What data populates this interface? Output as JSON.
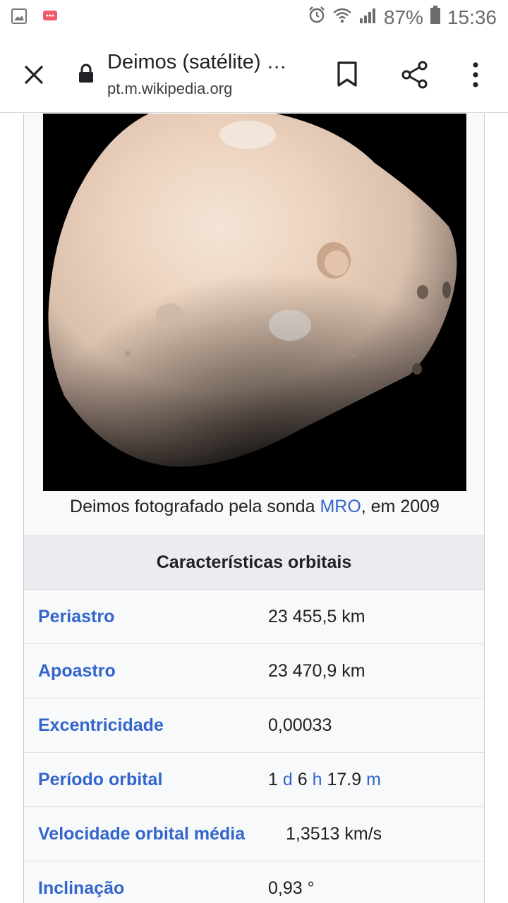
{
  "status_bar": {
    "battery_percent": "87%",
    "time": "15:36",
    "icons": [
      "image-notification-icon",
      "message-notification-icon",
      "alarm-icon",
      "wifi-icon",
      "signal-icon",
      "battery-icon"
    ]
  },
  "toolbar": {
    "page_title": "Deimos (satélite) …",
    "url": "pt.m.wikipedia.org",
    "icons": [
      "close-icon",
      "lock-icon",
      "bookmark-icon",
      "share-icon",
      "more-vert-icon"
    ]
  },
  "infobox": {
    "caption_prefix": "Deimos fotografado pela sonda ",
    "caption_link": "MRO",
    "caption_suffix": ", em 2009",
    "section_title": "Características orbitais",
    "rows": [
      {
        "label": "Periastro",
        "value": "23 455,5 km"
      },
      {
        "label": "Apoastro",
        "value": "23 470,9 km"
      },
      {
        "label": "Excentricidade",
        "value": "0,00033"
      },
      {
        "label": "Período orbital",
        "value_parts": {
          "n1": "1",
          "u1": "d",
          "n2": "6",
          "u2": "h",
          "n3": "17.9",
          "u3": "m"
        }
      },
      {
        "label": "Velocidade orbital média",
        "value": "1,3513 km/s"
      },
      {
        "label": "Inclinação",
        "value": "0,93 °"
      }
    ]
  },
  "colors": {
    "link": "#3366cc",
    "infobox_bg": "#f8f9fa",
    "section_bg": "#eaecf0",
    "text": "#202122"
  }
}
